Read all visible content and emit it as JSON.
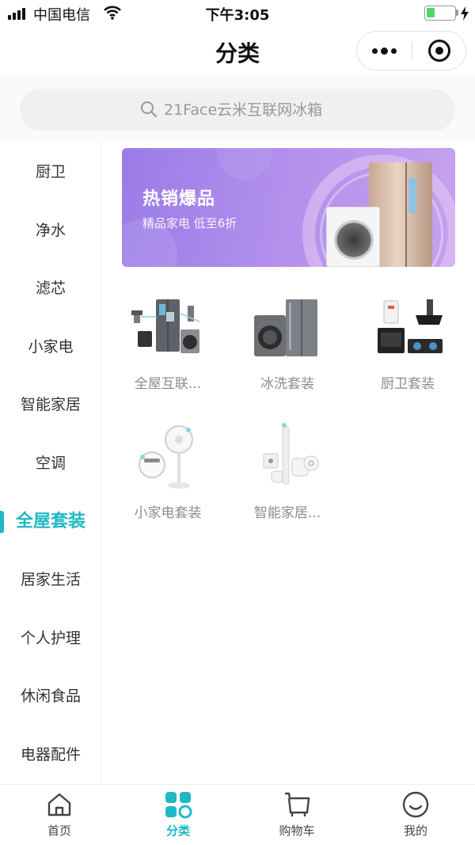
{
  "status_bar": {
    "carrier": "中国电信",
    "time": "下午3:05",
    "battery_level": 0.3
  },
  "header": {
    "title": "分类",
    "more_icon": "more-dots-icon",
    "close_icon": "target-icon"
  },
  "search": {
    "placeholder": "21Face云米互联网冰箱"
  },
  "sidebar": {
    "items": [
      {
        "label": "厨卫"
      },
      {
        "label": "净水"
      },
      {
        "label": "滤芯"
      },
      {
        "label": "小家电"
      },
      {
        "label": "智能家居"
      },
      {
        "label": "空调"
      },
      {
        "label": "全屋套装",
        "active": true
      },
      {
        "label": "居家生活"
      },
      {
        "label": "个人护理"
      },
      {
        "label": "休闲食品"
      },
      {
        "label": "电器配件"
      }
    ]
  },
  "banner": {
    "title": "热销爆品",
    "subtitle": "精品家电  低至6折"
  },
  "products": [
    {
      "label": "全屋互联...",
      "icon": "whole-house-set-image"
    },
    {
      "label": "冰洗套装",
      "icon": "fridge-washer-set-image"
    },
    {
      "label": "厨卫套装",
      "icon": "kitchen-bath-set-image"
    },
    {
      "label": "小家电套装",
      "icon": "small-appliance-set-image"
    },
    {
      "label": "智能家居...",
      "icon": "smart-home-set-image"
    }
  ],
  "tab_bar": {
    "tabs": [
      {
        "label": "首页",
        "icon": "home-icon"
      },
      {
        "label": "分类",
        "icon": "category-icon",
        "active": true
      },
      {
        "label": "购物车",
        "icon": "cart-icon"
      },
      {
        "label": "我的",
        "icon": "smile-icon"
      }
    ]
  },
  "colors": {
    "accent": "#1fb8c4",
    "banner_start": "#9b7ce8",
    "banner_end": "#c7a2ee"
  }
}
